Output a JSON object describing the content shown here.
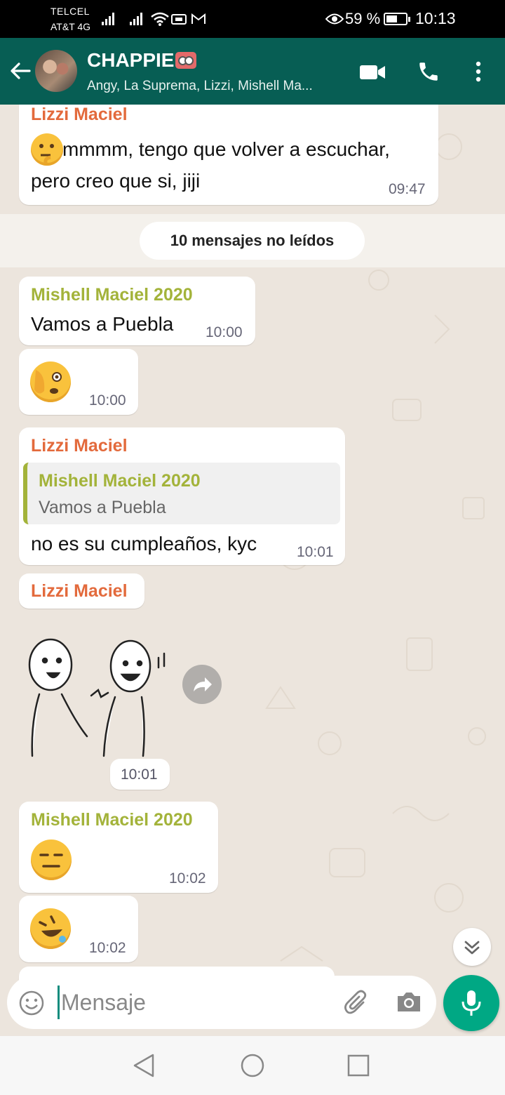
{
  "status_bar": {
    "carrier_1": "TELCEL",
    "carrier_2": "AT&T 4G",
    "battery_percent": "59 %",
    "battery_level": 0.59,
    "time": "10:13"
  },
  "header": {
    "title": "CHAPPIE",
    "subtitle": "Angy, La Suprema, Lizzi, Mishell Ma...",
    "icons": [
      "back-arrow-icon",
      "video-call-icon",
      "phone-icon",
      "more-options-icon"
    ]
  },
  "messages": [
    {
      "sender": "Lizzi Maciel",
      "text_line_1": "mmmm, tengo que volver a escuchar,",
      "text_line_2": "pero creo que si, jiji",
      "time": "09:47",
      "emoji": "thinking-face"
    },
    {
      "sender": "Mishell Maciel 2020",
      "text": "Vamos a Puebla",
      "time": "10:00"
    },
    {
      "emoji": "face-with-hand-over-eye",
      "time": "10:00"
    },
    {
      "sender": "Lizzi Maciel",
      "quote_sender": "Mishell Maciel 2020",
      "quote_text": "Vamos a Puebla",
      "text": "no es su cumpleaños, kyc",
      "time": "10:01"
    },
    {
      "sender": "Lizzi Maciel",
      "sticker": "two-laughing-cartoon-men",
      "time": "10:01"
    },
    {
      "sender": "Mishell Maciel 2020",
      "emoji": "expressionless-face",
      "time": "10:02"
    },
    {
      "emoji": "rolling-on-floor-laughing",
      "time": "10:02"
    }
  ],
  "unread_banner": "10 mensajes no leídos",
  "input": {
    "placeholder": "Mensaje"
  },
  "colors": {
    "header": "#075E54",
    "chat_background": "#ECE5DD",
    "lizzi_name": "#E36A3C",
    "mishell_name": "#A3B33A",
    "mic_button": "#00A884"
  }
}
